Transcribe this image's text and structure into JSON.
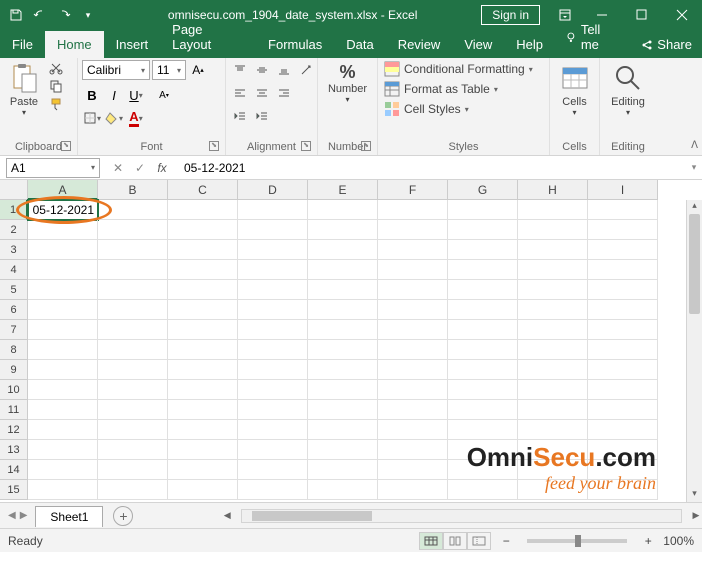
{
  "title": {
    "filename": "omnisecu.com_1904_date_system.xlsx",
    "app": "Excel",
    "separator": " - "
  },
  "signin": "Sign in",
  "tabs": {
    "file": "File",
    "home": "Home",
    "insert": "Insert",
    "page_layout": "Page Layout",
    "formulas": "Formulas",
    "data": "Data",
    "review": "Review",
    "view": "View",
    "help": "Help",
    "tellme": "Tell me",
    "share": "Share"
  },
  "ribbon": {
    "clipboard": {
      "label": "Clipboard",
      "paste": "Paste"
    },
    "font": {
      "label": "Font",
      "name": "Calibri",
      "size": "11"
    },
    "alignment": {
      "label": "Alignment"
    },
    "number": {
      "label": "Number",
      "btn": "Number",
      "pct": "%"
    },
    "styles": {
      "label": "Styles",
      "cond": "Conditional Formatting",
      "table": "Format as Table",
      "cell": "Cell Styles"
    },
    "cells": {
      "label": "Cells",
      "btn": "Cells"
    },
    "editing": {
      "label": "Editing",
      "btn": "Editing"
    }
  },
  "formula_bar": {
    "namebox": "A1",
    "fx": "fx",
    "value": "05-12-2021"
  },
  "grid": {
    "cols": [
      "A",
      "B",
      "C",
      "D",
      "E",
      "F",
      "G",
      "H",
      "I"
    ],
    "rows": [
      "1",
      "2",
      "3",
      "4",
      "5",
      "6",
      "7",
      "8",
      "9",
      "10",
      "11",
      "12",
      "13",
      "14",
      "15"
    ],
    "active_cell_value": "05-12-2021"
  },
  "watermark": {
    "main1": "Omni",
    "main2": "Secu",
    "main3": ".com",
    "sub": "feed your brain"
  },
  "sheet": {
    "name": "Sheet1"
  },
  "status": {
    "ready": "Ready",
    "zoom": "100%"
  }
}
